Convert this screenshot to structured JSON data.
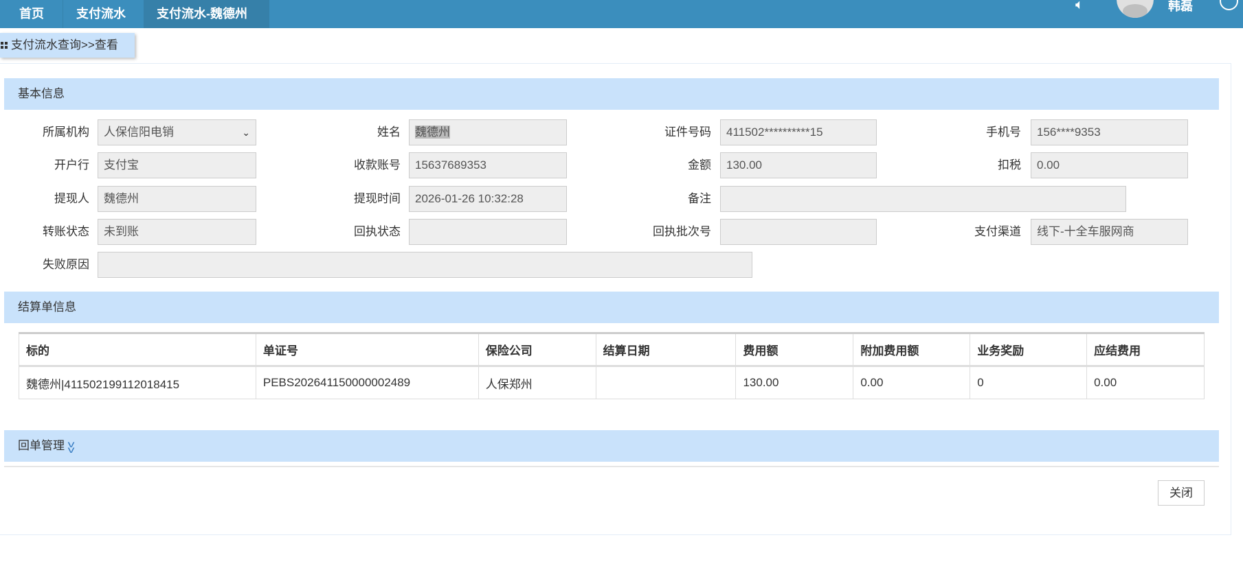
{
  "header": {
    "tabs": [
      "首页",
      "支付流水",
      "支付流水-魏德州"
    ],
    "user": "韩磊"
  },
  "breadcrumb": "支付流水查询>>查看",
  "basic": {
    "title": "基本信息",
    "fields": [
      {
        "label": "所属机构",
        "value": "人保信阳电销"
      },
      {
        "label": "姓名",
        "value": "魏德州"
      },
      {
        "label": "证件号码",
        "value": "411502**********15"
      },
      {
        "label": "手机号",
        "value": "156****9353"
      },
      {
        "label": "开户行",
        "value": "支付宝"
      },
      {
        "label": "收款账号",
        "value": "15637689353"
      },
      {
        "label": "金额",
        "value": "130.00"
      },
      {
        "label": "扣税",
        "value": "0.00"
      },
      {
        "label": "提现人",
        "value": "魏德州"
      },
      {
        "label": "提现时间",
        "value": "2026-01-26 10:32:28"
      },
      {
        "label": "备注",
        "value": ""
      },
      {
        "label": "转账状态",
        "value": "未到账"
      },
      {
        "label": "回执状态",
        "value": ""
      },
      {
        "label": "回执批次号",
        "value": ""
      },
      {
        "label": "支付渠道",
        "value": "线下-十全车服网商"
      },
      {
        "label": "失败原因",
        "value": ""
      }
    ]
  },
  "settlement": {
    "title": "结算单信息",
    "columns": [
      "标的",
      "单证号",
      "保险公司",
      "结算日期",
      "费用额",
      "附加费用额",
      "业务奖励",
      "应结费用"
    ],
    "rows": [
      [
        "魏德州|411502199112018415",
        "PEBS202641150000002489",
        "人保郑州",
        "",
        "130.00",
        "0.00",
        "0",
        "0.00"
      ]
    ]
  },
  "receipt": {
    "title": "回单管理"
  },
  "close_label": "关闭"
}
